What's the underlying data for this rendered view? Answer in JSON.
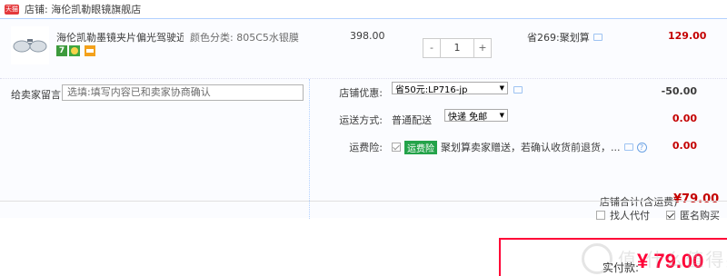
{
  "store": {
    "icon_text": "天猫",
    "label": "店铺: 海伦凯勒眼镜旗舰店"
  },
  "item": {
    "title": "海伦凯勒墨镜夹片偏光驾驶近视...",
    "spec": "颜色分类: 805C5水银膜",
    "badges": [
      "7",
      "guarantee-badge",
      "card-badge"
    ],
    "unit_price": "398.00",
    "quantity": "1",
    "qty_minus": "-",
    "qty_plus": "+",
    "promo": "省269:聚划算",
    "total": "129.00"
  },
  "message": {
    "label": "给卖家留言:",
    "placeholder": "选填:填写内容已和卖家协商确认"
  },
  "coupon": {
    "label": "店铺优惠:",
    "selected": "省50元:LP716-jp",
    "value": "-50.00"
  },
  "shipping": {
    "label": "运送方式:",
    "method": "普通配送",
    "selected": "快递 免邮",
    "value": "0.00"
  },
  "insurance": {
    "label": "运费险:",
    "tag": "运费险",
    "text": "聚划算卖家赠送，若确认收货前退货，...",
    "value": "0.00"
  },
  "store_total": {
    "label": "店铺合计(含运费)",
    "value": "¥79.00"
  },
  "options": {
    "proxy_pay": "找人代付",
    "anonymous": "匿名购买"
  },
  "payment": {
    "label": "实付款:",
    "value": "¥ 79.00"
  },
  "watermark": {
    "text": "值 什么值得买"
  },
  "colors": {
    "price_red": "#c40000",
    "pay_red": "#ff0036",
    "panel_bg": "#fbfcff",
    "border_blue": "#b2d1ff"
  }
}
